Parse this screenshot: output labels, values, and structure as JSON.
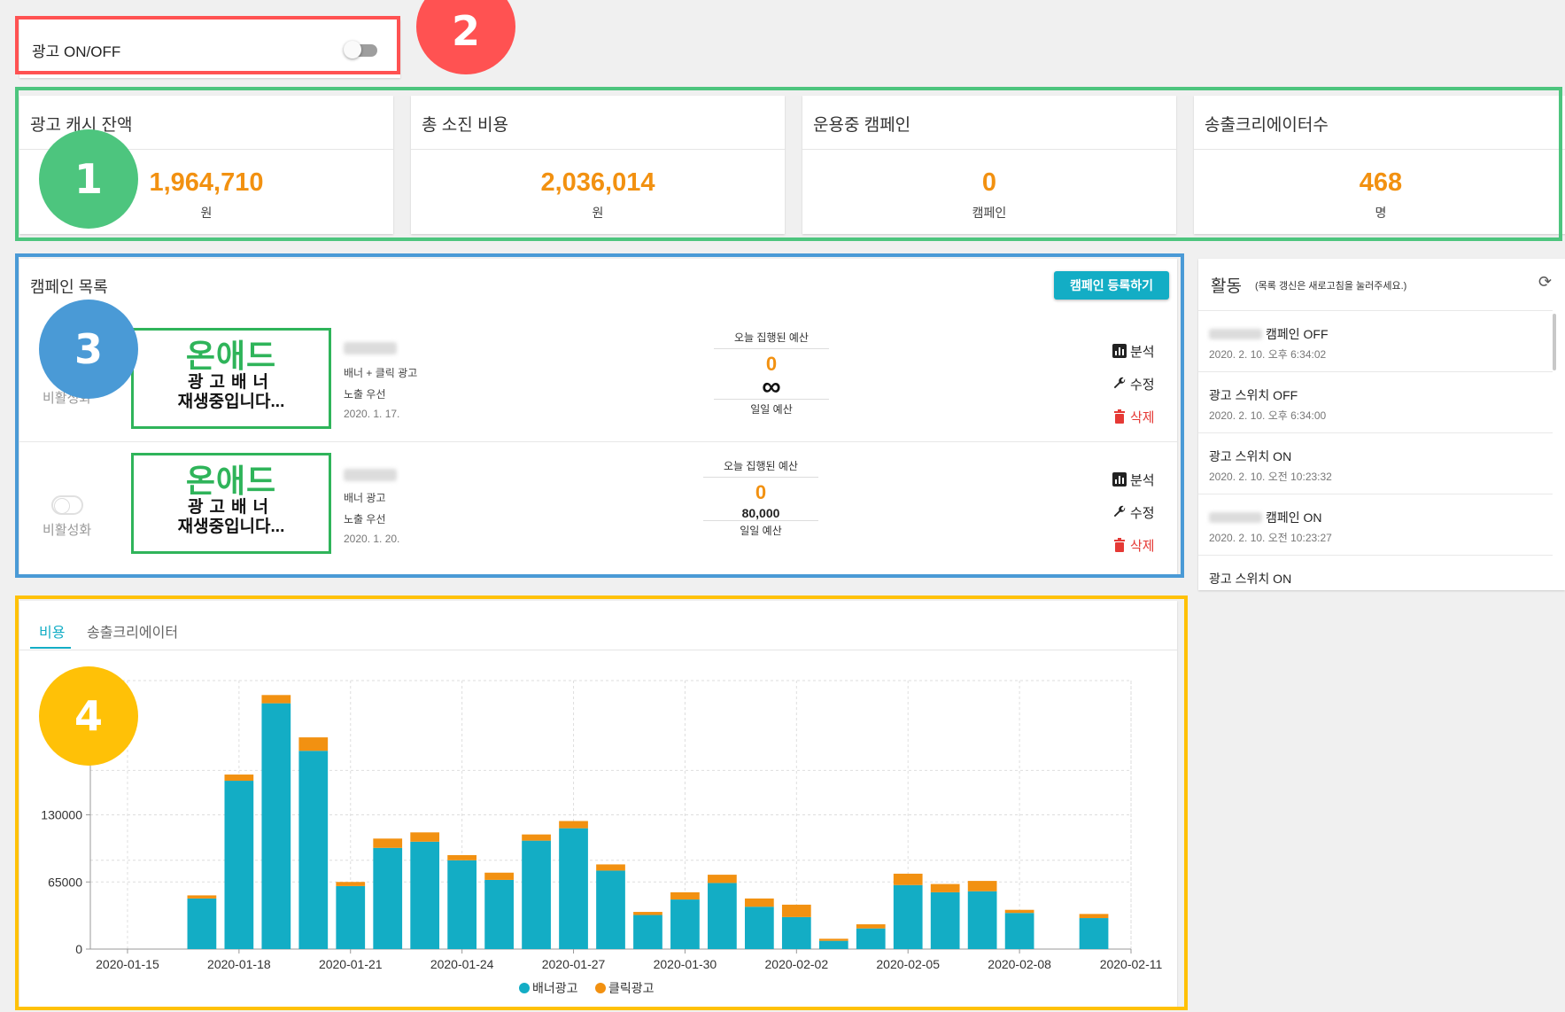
{
  "ad_toggle": {
    "label": "광고 ON/OFF"
  },
  "stats": [
    {
      "title": "광고 캐시 잔액",
      "value": "1,964,710",
      "unit": "원"
    },
    {
      "title": "총 소진 비용",
      "value": "2,036,014",
      "unit": "원"
    },
    {
      "title": "운용중 캠페인",
      "value": "0",
      "unit": "캠페인"
    },
    {
      "title": "송출크리에이터수",
      "value": "468",
      "unit": "명"
    }
  ],
  "campaigns": {
    "title": "캠페인 목록",
    "register_label": "캠페인 등록하기",
    "rows": [
      {
        "status": "비활성화",
        "banner": {
          "brand": "온애드",
          "line1": "광고배너",
          "line2": "재생중입니다..."
        },
        "type": "배너 + 클릭 광고",
        "priority": "노출 우선",
        "date": "2020. 1. 17.",
        "budget_label": "오늘 집행된 예산",
        "budget_today": "0",
        "budget_daily": "∞",
        "daily_label": "일일 예산"
      },
      {
        "status": "비활성화",
        "banner": {
          "brand": "온애드",
          "line1": "광고배너",
          "line2": "재생중입니다..."
        },
        "type": "배너 광고",
        "priority": "노출 우선",
        "date": "2020. 1. 20.",
        "budget_label": "오늘 집행된 예산",
        "budget_today": "0",
        "budget_daily": "80,000",
        "daily_label": "일일 예산"
      }
    ],
    "actions": {
      "analyze": "분석",
      "edit": "수정",
      "delete": "삭제"
    }
  },
  "activity": {
    "title": "활동",
    "hint": "(목록 갱신은 새로고침을 눌러주세요.)",
    "items": [
      {
        "text": "캠페인 OFF",
        "blurred": true,
        "time": "2020. 2. 10. 오후 6:34:02"
      },
      {
        "text": "광고 스위치 OFF",
        "blurred": false,
        "time": "2020. 2. 10. 오후 6:34:00"
      },
      {
        "text": "광고 스위치 ON",
        "blurred": false,
        "time": "2020. 2. 10. 오전 10:23:32"
      },
      {
        "text": "캠페인 ON",
        "blurred": true,
        "time": "2020. 2. 10. 오전 10:23:27"
      },
      {
        "text": "광고 스위치 ON",
        "blurred": false,
        "time": ""
      }
    ]
  },
  "chart_tabs": [
    "비용",
    "송출크리에이터"
  ],
  "badges": [
    "1",
    "2",
    "3",
    "4"
  ],
  "colors": {
    "accent": "#13adc5",
    "orange": "#f29111",
    "banner_green": "#2fb45a"
  },
  "chart_data": {
    "type": "bar",
    "stacked": true,
    "x_tick_labels": [
      "2020-01-15",
      "2020-01-18",
      "2020-01-21",
      "2020-01-24",
      "2020-01-27",
      "2020-01-30",
      "2020-02-02",
      "2020-02-05",
      "2020-02-08",
      "2020-02-11"
    ],
    "y_tick_labels": [
      "0",
      "65000",
      "130000"
    ],
    "dates": [
      "2020-01-17",
      "2020-01-18",
      "2020-01-19",
      "2020-01-20",
      "2020-01-21",
      "2020-01-22",
      "2020-01-23",
      "2020-01-24",
      "2020-01-25",
      "2020-01-26",
      "2020-01-27",
      "2020-01-28",
      "2020-01-29",
      "2020-01-30",
      "2020-01-31",
      "2020-02-01",
      "2020-02-02",
      "2020-02-03",
      "2020-02-04",
      "2020-02-05",
      "2020-02-06",
      "2020-02-07",
      "2020-02-08",
      "2020-02-09",
      "2020-02-10"
    ],
    "series": [
      {
        "name": "배너광고",
        "color": "#13adc5",
        "values": [
          49000,
          163000,
          238000,
          192000,
          61000,
          98000,
          104000,
          86000,
          67000,
          105000,
          117000,
          76000,
          33000,
          48000,
          64000,
          41000,
          31000,
          8000,
          20000,
          62000,
          55000,
          56000,
          35000,
          0,
          30000
        ]
      },
      {
        "name": "클릭광고",
        "color": "#f29111",
        "values": [
          3000,
          6000,
          8000,
          13000,
          4000,
          9000,
          9000,
          5000,
          7000,
          6000,
          7000,
          6000,
          3000,
          7000,
          8000,
          8000,
          12000,
          2000,
          4000,
          11000,
          8000,
          10000,
          3000,
          0,
          4000
        ]
      }
    ],
    "ylim": [
      0,
      260000
    ]
  }
}
